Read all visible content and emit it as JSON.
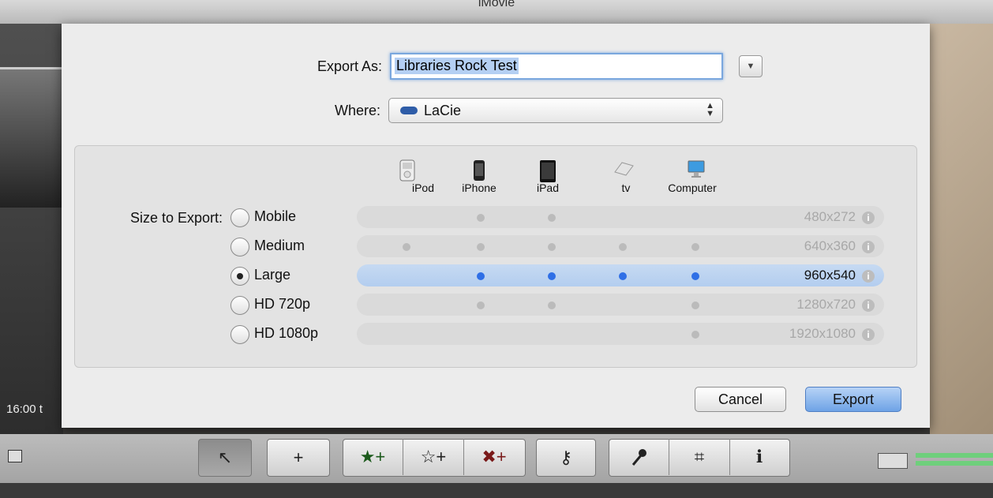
{
  "window": {
    "title": "iMovie"
  },
  "background": {
    "timestamp": "16:00 t"
  },
  "dialog": {
    "export_as_label": "Export As:",
    "export_as_value": "Libraries Rock Test",
    "where_label": "Where:",
    "where_value": "LaCie",
    "size_label": "Size to Export:",
    "devices": [
      "iPod",
      "iPhone",
      "iPad",
      "tv",
      "Computer"
    ],
    "options": [
      {
        "label": "Mobile",
        "resolution": "480x272",
        "selected": false,
        "devices": [
          false,
          true,
          true,
          false,
          false
        ]
      },
      {
        "label": "Medium",
        "resolution": "640x360",
        "selected": false,
        "devices": [
          true,
          true,
          true,
          true,
          true
        ]
      },
      {
        "label": "Large",
        "resolution": "960x540",
        "selected": true,
        "devices": [
          false,
          true,
          true,
          true,
          true
        ]
      },
      {
        "label": "HD 720p",
        "resolution": "1280x720",
        "selected": false,
        "devices": [
          false,
          true,
          true,
          false,
          true
        ]
      },
      {
        "label": "HD 1080p",
        "resolution": "1920x1080",
        "selected": false,
        "devices": [
          false,
          false,
          false,
          false,
          true
        ]
      }
    ],
    "cancel_label": "Cancel",
    "export_label": "Export",
    "info_glyph": "i"
  },
  "toolbar": {
    "icons": [
      "pointer-icon",
      "add-photo-icon",
      "favorite-icon",
      "unmark-icon",
      "reject-icon",
      "keyword-icon",
      "voiceover-icon",
      "crop-icon",
      "info-icon"
    ],
    "glyphs": {
      "pointer": "↖",
      "photo_plus": "+",
      "star_plus": "★+",
      "outline_star_plus": "☆+",
      "x_plus": "✖+",
      "key": "⚷",
      "mic": "🎤",
      "crop": "⌗",
      "info": "ℹ"
    }
  },
  "colors": {
    "accent": "#2f6fe6",
    "selection": "#b4cff3"
  }
}
